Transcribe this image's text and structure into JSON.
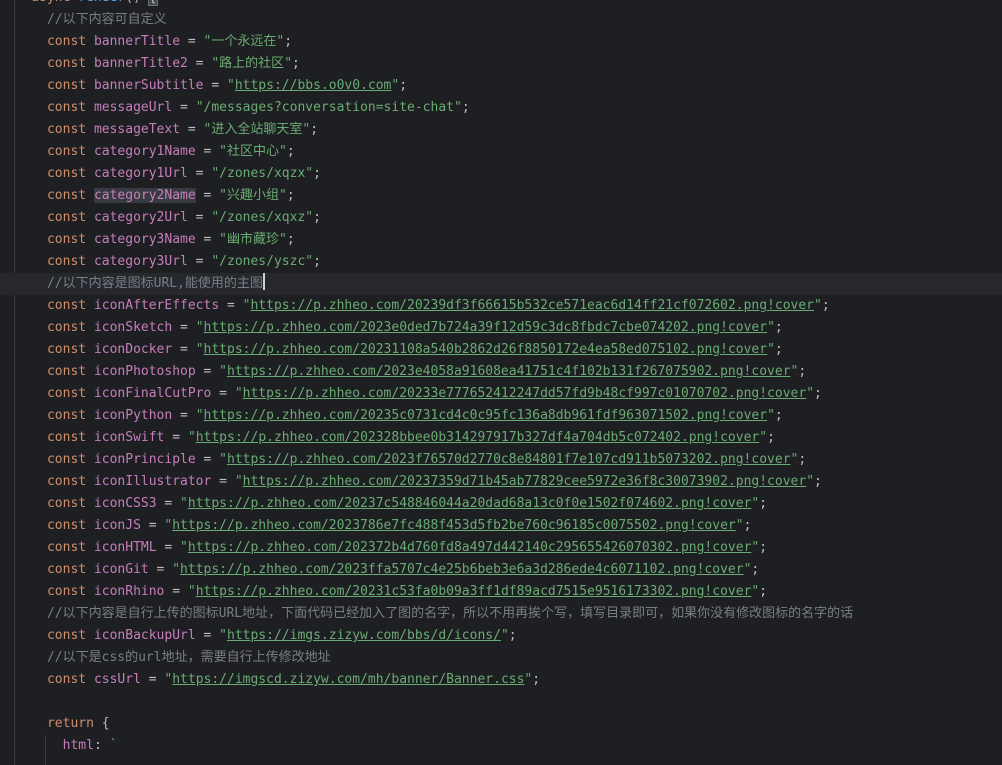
{
  "editor": {
    "method": "render",
    "keyword_async": "async",
    "comments": {
      "custom": "//以下内容可自定义",
      "icons": "//以下内容是图标URL,能使用的主图",
      "upload": "//以下内容是自行上传的图标URL地址，下面代码已经加入了图的名字，所以不用再挨个写，填写目录即可，如果你没有修改图标的名字的话",
      "css": "//以下是css的url地址，需要自行上传修改地址"
    },
    "declarations": [
      {
        "name": "bannerTitle",
        "value": "一个永远在",
        "is_url": false
      },
      {
        "name": "bannerTitle2",
        "value": "路上的社区",
        "is_url": false
      },
      {
        "name": "bannerSubtitle",
        "value": "https://bbs.o0v0.com",
        "is_url": true
      },
      {
        "name": "messageUrl",
        "value": "/messages?conversation=site-chat",
        "is_url": false
      },
      {
        "name": "messageText",
        "value": "进入全站聊天室",
        "is_url": false
      },
      {
        "name": "category1Name",
        "value": "社区中心",
        "is_url": false
      },
      {
        "name": "category1Url",
        "value": "/zones/xqzx",
        "is_url": false
      },
      {
        "name": "category2Name",
        "value": "兴趣小组",
        "is_url": false
      },
      {
        "name": "category2Url",
        "value": "/zones/xqxz",
        "is_url": false
      },
      {
        "name": "category3Name",
        "value": "幽市藏珍",
        "is_url": false
      },
      {
        "name": "category3Url",
        "value": "/zones/yszc",
        "is_url": false
      }
    ],
    "icons": [
      {
        "name": "iconAfterEffects",
        "value": "https://p.zhheo.com/20239df3f66615b532ce571eac6d14ff21cf072602.png!cover"
      },
      {
        "name": "iconSketch",
        "value": "https://p.zhheo.com/2023e0ded7b724a39f12d59c3dc8fbdc7cbe074202.png!cover"
      },
      {
        "name": "iconDocker",
        "value": "https://p.zhheo.com/20231108a540b2862d26f8850172e4ea58ed075102.png!cover"
      },
      {
        "name": "iconPhotoshop",
        "value": "https://p.zhheo.com/2023e4058a91608ea41751c4f102b131f267075902.png!cover"
      },
      {
        "name": "iconFinalCutPro",
        "value": "https://p.zhheo.com/20233e777652412247dd57fd9b48cf997c01070702.png!cover"
      },
      {
        "name": "iconPython",
        "value": "https://p.zhheo.com/20235c0731cd4c0c95fc136a8db961fdf963071502.png!cover"
      },
      {
        "name": "iconSwift",
        "value": "https://p.zhheo.com/202328bbee0b314297917b327df4a704db5c072402.png!cover"
      },
      {
        "name": "iconPrinciple",
        "value": "https://p.zhheo.com/2023f76570d2770c8e84801f7e107cd911b5073202.png!cover"
      },
      {
        "name": "iconIllustrator",
        "value": "https://p.zhheo.com/20237359d71b45ab77829cee5972e36f8c30073902.png!cover"
      },
      {
        "name": "iconCSS3",
        "value": "https://p.zhheo.com/20237c548846044a20dad68a13c0f0e1502f074602.png!cover"
      },
      {
        "name": "iconJS",
        "value": "https://p.zhheo.com/2023786e7fc488f453d5fb2be760c96185c0075502.png!cover"
      },
      {
        "name": "iconHTML",
        "value": "https://p.zhheo.com/202372b4d760fd8a497d442140c295655426070302.png!cover"
      },
      {
        "name": "iconGit",
        "value": "https://p.zhheo.com/2023ffa5707c4e25b6beb3e6a3d286ede4c6071102.png!cover"
      },
      {
        "name": "iconRhino",
        "value": "https://p.zhheo.com/20231c53fa0b09a3ff1df89acd7515e9516173302.png!cover"
      }
    ],
    "backup": {
      "name": "iconBackupUrl",
      "value": "https://imgs.zizyw.com/bbs/d/icons/"
    },
    "css": {
      "name": "cssUrl",
      "value": "https://imgscd.zizyw.com/mh/banner/Banner.css"
    },
    "keyword_const": "const",
    "keyword_return": "return",
    "html_prop": "html",
    "colors": {
      "background": "#1e1f22",
      "keyword": "#cf8e6d",
      "variable": "#c77dbb",
      "string": "#6aab73",
      "comment": "#7a7e85",
      "function": "#56a8f5",
      "text": "#bcbec4"
    }
  }
}
